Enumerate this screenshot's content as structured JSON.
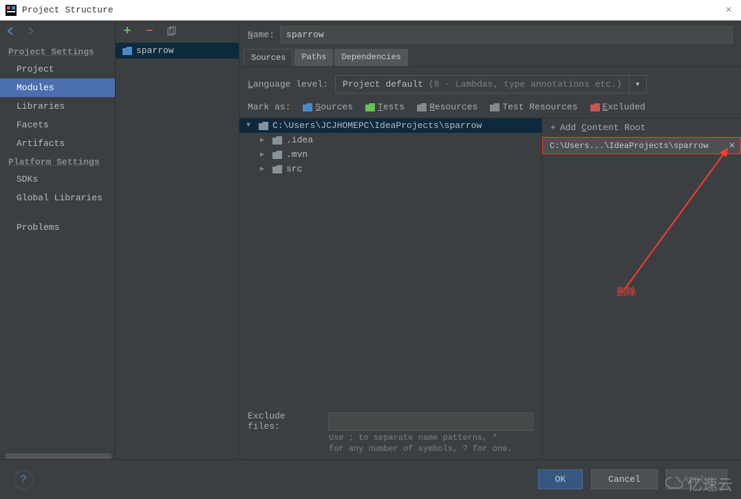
{
  "window_title": "Project Structure",
  "nav": {
    "heading_settings": "Project Settings",
    "heading_platform": "Platform Settings",
    "items": {
      "project": "Project",
      "modules": "Modules",
      "libraries": "Libraries",
      "facets": "Facets",
      "artifacts": "Artifacts",
      "sdks": "SDKs",
      "global_libraries": "Global Libraries",
      "problems": "Problems"
    }
  },
  "module": {
    "selected": "sparrow"
  },
  "form": {
    "name_label": "Name:",
    "name_value": "sparrow",
    "tabs": {
      "sources": "Sources",
      "paths": "Paths",
      "dependencies": "Dependencies"
    },
    "language_label": "Language level:",
    "language_value": "Project default ",
    "language_suffix": "(8 - Lambdas, type annotations etc.)",
    "mark_label": "Mark as:",
    "mark": {
      "sources": "Sources",
      "tests": "Tests",
      "resources": "Resources",
      "test_resources": "Test Resources",
      "excluded": "Excluded"
    }
  },
  "tree": {
    "root": "C:\\Users\\JCJHOMEPC\\IdeaProjects\\sparrow",
    "children": [
      ".idea",
      ".mvn",
      "src"
    ]
  },
  "content": {
    "add_label": "Add Content Root",
    "root_path": "C:\\Users...\\IdeaProjects\\sparrow"
  },
  "exclude": {
    "label": "Exclude files:",
    "hint1": "Use ; to separate name patterns, *",
    "hint2": "for any number of symbols, ? for one."
  },
  "buttons": {
    "ok": "OK",
    "cancel": "Cancel",
    "apply": "Apply"
  },
  "annotation": {
    "text": "删除"
  },
  "watermark": "亿速云"
}
